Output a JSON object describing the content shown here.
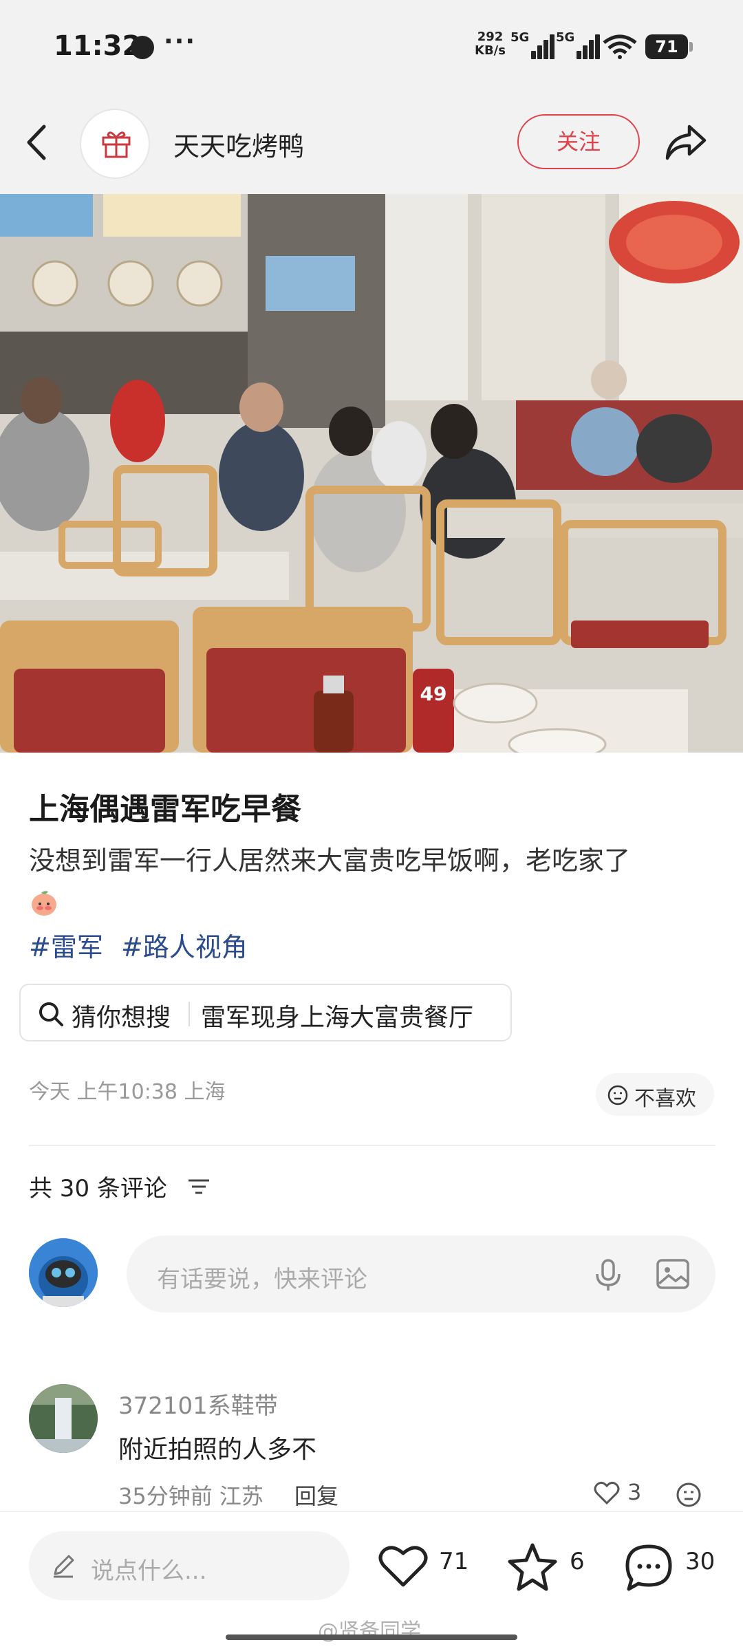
{
  "status": {
    "time": "11:32",
    "dots": "···",
    "speed_value": "292",
    "speed_unit": "KB/s",
    "sim1_label": "5G",
    "sim2_label": "5G",
    "battery": "71"
  },
  "header": {
    "author": "天天吃烤鸭",
    "follow_label": "关注"
  },
  "post": {
    "title": "上海偶遇雷军吃早餐",
    "body": "没想到雷军一行人居然来大富贵吃早饭啊，老吃家了",
    "tags": [
      "#雷军",
      "#路人视角"
    ],
    "guess_label": "猜你想搜",
    "guess_query": "雷军现身上海大富贵餐厅",
    "meta": "今天 上午10:38 上海",
    "dislike_label": "不喜欢",
    "photo_table_number": "49"
  },
  "comments": {
    "count_label": "共 30 条评论",
    "input_placeholder": "有话要说，快来评论",
    "items": [
      {
        "user": "372101系鞋带",
        "text": "附近拍照的人多不",
        "time": "35分钟前 江苏",
        "reply_label": "回复",
        "likes": "3"
      }
    ]
  },
  "bottom": {
    "say_placeholder": "说点什么...",
    "like_count": "71",
    "star_count": "6",
    "comment_count": "30",
    "watermark": "@贤备同学"
  },
  "colors": {
    "accent": "#e0414a",
    "tag": "#2b4b8f"
  }
}
